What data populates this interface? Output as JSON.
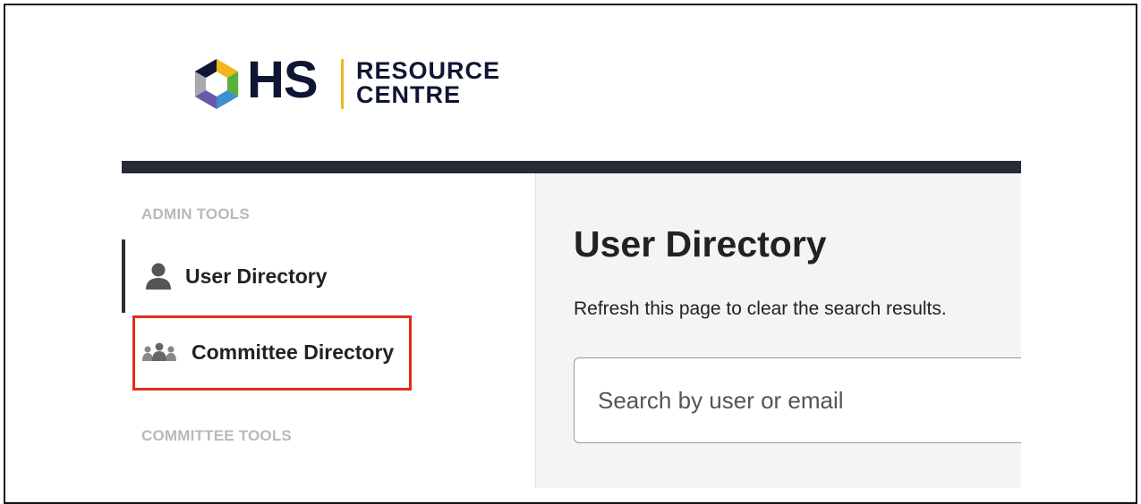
{
  "logo": {
    "mark": "OHS",
    "line1": "RESOURCE",
    "line2": "CENTRE",
    "colors": {
      "navy": "#0e1633",
      "yellow": "#f2b51d",
      "green": "#5aae3c",
      "blue": "#3d8fd1",
      "purple": "#6b58a8",
      "gray": "#a7a9ac"
    }
  },
  "sidebar": {
    "admin_heading": "ADMIN TOOLS",
    "items": [
      {
        "label": "User Directory",
        "icon": "user-icon",
        "active": true
      },
      {
        "label": "Committee Directory",
        "icon": "group-icon",
        "active": false
      }
    ],
    "committee_heading": "COMMITTEE TOOLS"
  },
  "main": {
    "title": "User Directory",
    "helper": "Refresh this page to clear the search results.",
    "search": {
      "placeholder": "Search by user or email",
      "value": ""
    }
  },
  "colors": {
    "topbar": "#262b35",
    "highlight": "#e32b1c",
    "main_bg": "#f4f4f4"
  }
}
